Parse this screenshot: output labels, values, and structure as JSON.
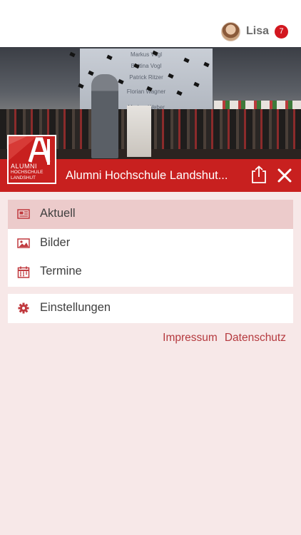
{
  "header": {
    "user_name": "Lisa",
    "notification_count": "7"
  },
  "hero": {
    "screen_names": [
      "Markus Vogl",
      "Bettina Vogl",
      "Patrick Ritzer",
      "Florian Wagner",
      "Markus Weber"
    ]
  },
  "logo": {
    "line1": "ALUMNI",
    "line2": "HOCHSCHULE",
    "line3": "LANDSHUT"
  },
  "titlebar": {
    "title": "Alumni Hochschule Landshut..."
  },
  "menu": {
    "items": [
      {
        "label": "Aktuell",
        "icon": "newspaper-icon",
        "active": true
      },
      {
        "label": "Bilder",
        "icon": "image-icon",
        "active": false
      },
      {
        "label": "Termine",
        "icon": "calendar-icon",
        "active": false
      }
    ],
    "settings": {
      "label": "Einstellungen",
      "icon": "gear-icon"
    }
  },
  "footer_links": {
    "impressum": "Impressum",
    "datenschutz": "Datenschutz"
  },
  "colors": {
    "brand_red": "#c8201f",
    "background": "#f7e8e8",
    "active_item": "#eccbcb",
    "link": "#b53a3f"
  }
}
